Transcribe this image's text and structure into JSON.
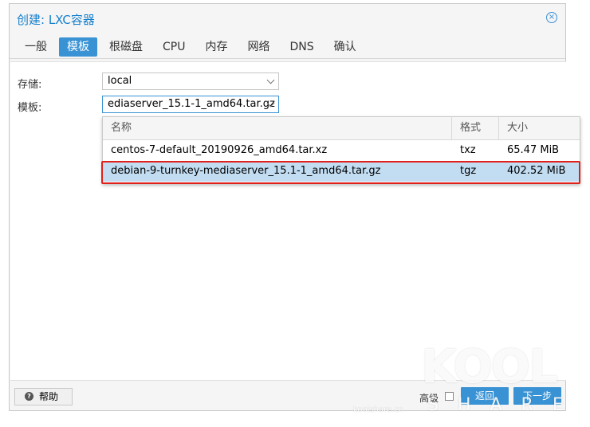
{
  "dialog": {
    "title": "创建: LXC容器",
    "close_icon": "×"
  },
  "tabs": [
    {
      "label": "一般",
      "active": false
    },
    {
      "label": "模板",
      "active": true
    },
    {
      "label": "根磁盘",
      "active": false
    },
    {
      "label": "CPU",
      "active": false
    },
    {
      "label": "内存",
      "active": false
    },
    {
      "label": "网络",
      "active": false
    },
    {
      "label": "DNS",
      "active": false
    },
    {
      "label": "确认",
      "active": false
    }
  ],
  "form": {
    "storage_label": "存储:",
    "storage_value": "local",
    "template_label": "模板:",
    "template_value": "ediaserver_15.1-1_amd64.tar.gz"
  },
  "grid": {
    "columns": [
      "名称",
      "格式",
      "大小"
    ],
    "rows": [
      {
        "name": "centos-7-default_20190926_amd64.tar.xz",
        "format": "txz",
        "size": "65.47 MiB",
        "selected": false
      },
      {
        "name": "debian-9-turnkey-mediaserver_15.1-1_amd64.tar.gz",
        "format": "tgz",
        "size": "402.52 MiB",
        "selected": true
      }
    ]
  },
  "footer": {
    "help_label": "帮助",
    "help_icon": "?",
    "advanced_label": "高级",
    "back_label": "返回",
    "next_label": "下一步"
  },
  "watermark": {
    "logo": "KOOL",
    "share": "SHARE",
    "site": "koolshare.cn"
  },
  "colors": {
    "accent": "#3892d4",
    "title": "#157fcc",
    "selected_row": "#c2ddf2",
    "highlight_border": "#e0201b"
  }
}
